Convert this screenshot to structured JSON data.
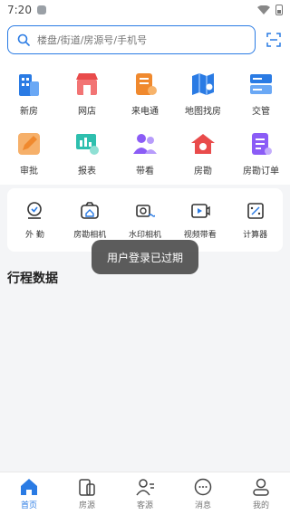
{
  "status": {
    "time": "7:20"
  },
  "search": {
    "placeholder": "楼盘/街道/房源号/手机号"
  },
  "grid": {
    "row1": [
      {
        "label": "新房",
        "icon": "building-icon"
      },
      {
        "label": "网店",
        "icon": "shop-icon"
      },
      {
        "label": "来电通",
        "icon": "phone-note-icon"
      },
      {
        "label": "地图找房",
        "icon": "map-icon"
      },
      {
        "label": "交管",
        "icon": "server-icon"
      }
    ],
    "row2": [
      {
        "label": "审批",
        "icon": "pencil-icon"
      },
      {
        "label": "报表",
        "icon": "report-icon"
      },
      {
        "label": "带看",
        "icon": "people-icon"
      },
      {
        "label": "房勘",
        "icon": "house-survey-icon"
      },
      {
        "label": "房勘订单",
        "icon": "order-doc-icon"
      }
    ]
  },
  "tools": [
    {
      "label": "外 勤",
      "icon": "location-badge-icon"
    },
    {
      "label": "房勘相机",
      "icon": "house-camera-icon"
    },
    {
      "label": "水印相机",
      "icon": "watermark-camera-icon"
    },
    {
      "label": "视频带看",
      "icon": "video-icon"
    },
    {
      "label": "计算器",
      "icon": "calculator-icon"
    }
  ],
  "section": {
    "title": "行程数据"
  },
  "toast": {
    "text": "用户登录已过期"
  },
  "nav": [
    {
      "label": "首页",
      "icon": "home-icon",
      "active": true
    },
    {
      "label": "房源",
      "icon": "house-source-icon",
      "active": false
    },
    {
      "label": "客源",
      "icon": "customer-icon",
      "active": false
    },
    {
      "label": "消息",
      "icon": "message-icon",
      "active": false
    },
    {
      "label": "我的",
      "icon": "profile-icon",
      "active": false
    }
  ],
  "colors": {
    "accent": "#2a7be4",
    "orange": "#f0892e",
    "red": "#e94b4b",
    "purple": "#8b5cf6"
  }
}
